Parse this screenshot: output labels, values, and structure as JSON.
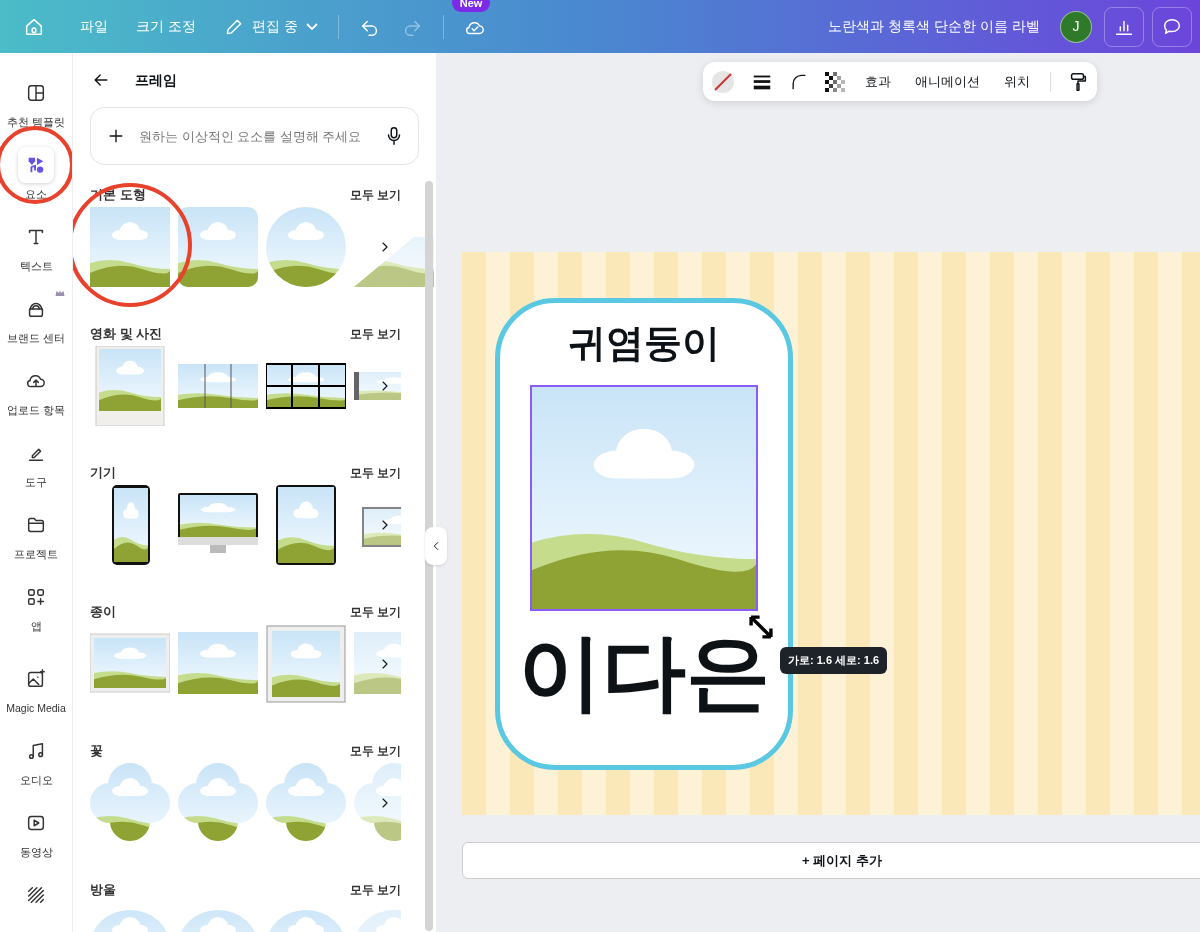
{
  "top_bar": {
    "menu": [
      "파일",
      "크기 조정"
    ],
    "mode": "편집 중",
    "redo_disabled": true,
    "new_badge": "New",
    "document_title": "노란색과 청록색 단순한 이름 라벨",
    "avatar_initial": "J"
  },
  "sidebar": {
    "items": [
      {
        "label": "추천 템플릿",
        "selected": false,
        "circled": false,
        "premium": false
      },
      {
        "label": "요소",
        "selected": true,
        "circled": true,
        "premium": false
      },
      {
        "label": "텍스트",
        "selected": false,
        "circled": false,
        "premium": false
      },
      {
        "label": "브랜드 센터",
        "selected": false,
        "circled": false,
        "premium": true
      },
      {
        "label": "업로드 항목",
        "selected": false,
        "circled": false,
        "premium": false
      },
      {
        "label": "도구",
        "selected": false,
        "circled": false,
        "premium": false
      },
      {
        "label": "프로젝트",
        "selected": false,
        "circled": false,
        "premium": false
      },
      {
        "label": "앱",
        "selected": false,
        "circled": false,
        "premium": false
      },
      {
        "label": "Magic Media",
        "selected": false,
        "circled": false,
        "premium": false
      },
      {
        "label": "오디오",
        "selected": false,
        "circled": false,
        "premium": false
      },
      {
        "label": "동영상",
        "selected": false,
        "circled": false,
        "premium": false
      },
      {
        "selected": false,
        "circled": false,
        "premium": false
      }
    ]
  },
  "panel": {
    "title": "프레임",
    "search_placeholder": "원하는 이상적인 요소를 설명해 주세요",
    "sections": [
      {
        "title": "기본 도형",
        "see_all": "모두 보기",
        "items": [
          {
            "kind": "square",
            "circled": true
          },
          {
            "kind": "rounded",
            "circled": false
          },
          {
            "kind": "circle",
            "circled": false
          },
          {
            "kind": "triangle",
            "circled": false
          }
        ]
      },
      {
        "title": "영화 및 사진",
        "see_all": "모두 보기",
        "items": [
          {
            "kind": "polaroid",
            "circled": false
          },
          {
            "kind": "triptych",
            "circled": false
          },
          {
            "kind": "film",
            "circled": false
          },
          {
            "kind": "strip",
            "circled": false
          }
        ]
      },
      {
        "title": "기기",
        "see_all": "모두 보기",
        "items": [
          {
            "kind": "phone",
            "circled": false
          },
          {
            "kind": "monitor",
            "circled": false
          },
          {
            "kind": "tablet",
            "circled": false
          },
          {
            "kind": "laptop",
            "circled": false
          }
        ]
      },
      {
        "title": "종이",
        "see_all": "모두 보기",
        "items": [
          {
            "kind": "paper",
            "circled": false
          },
          {
            "kind": "torn",
            "circled": false
          },
          {
            "kind": "sketch",
            "circled": false
          },
          {
            "kind": "torn",
            "circled": false
          }
        ]
      },
      {
        "title": "꽃",
        "see_all": "모두 보기",
        "items": [
          {
            "kind": "cloud",
            "circled": false
          },
          {
            "kind": "cloud",
            "circled": false
          },
          {
            "kind": "cloud",
            "circled": false
          },
          {
            "kind": "cloud",
            "circled": false
          }
        ]
      },
      {
        "title": "방울",
        "see_all": "모두 보기",
        "items": [
          {
            "kind": "bubble",
            "circled": false
          },
          {
            "kind": "bubble",
            "circled": false
          },
          {
            "kind": "bubble",
            "circled": false
          },
          {
            "kind": "bubble",
            "circled": false
          }
        ]
      }
    ]
  },
  "toolbar": {
    "items": [
      "효과",
      "애니메이션",
      "위치"
    ]
  },
  "canvas": {
    "label_title": "귀염둥이",
    "label_name": "이다은",
    "tooltip": "가로: 1.6 세로: 1.6",
    "add_page": "+ 페이지 추가"
  }
}
